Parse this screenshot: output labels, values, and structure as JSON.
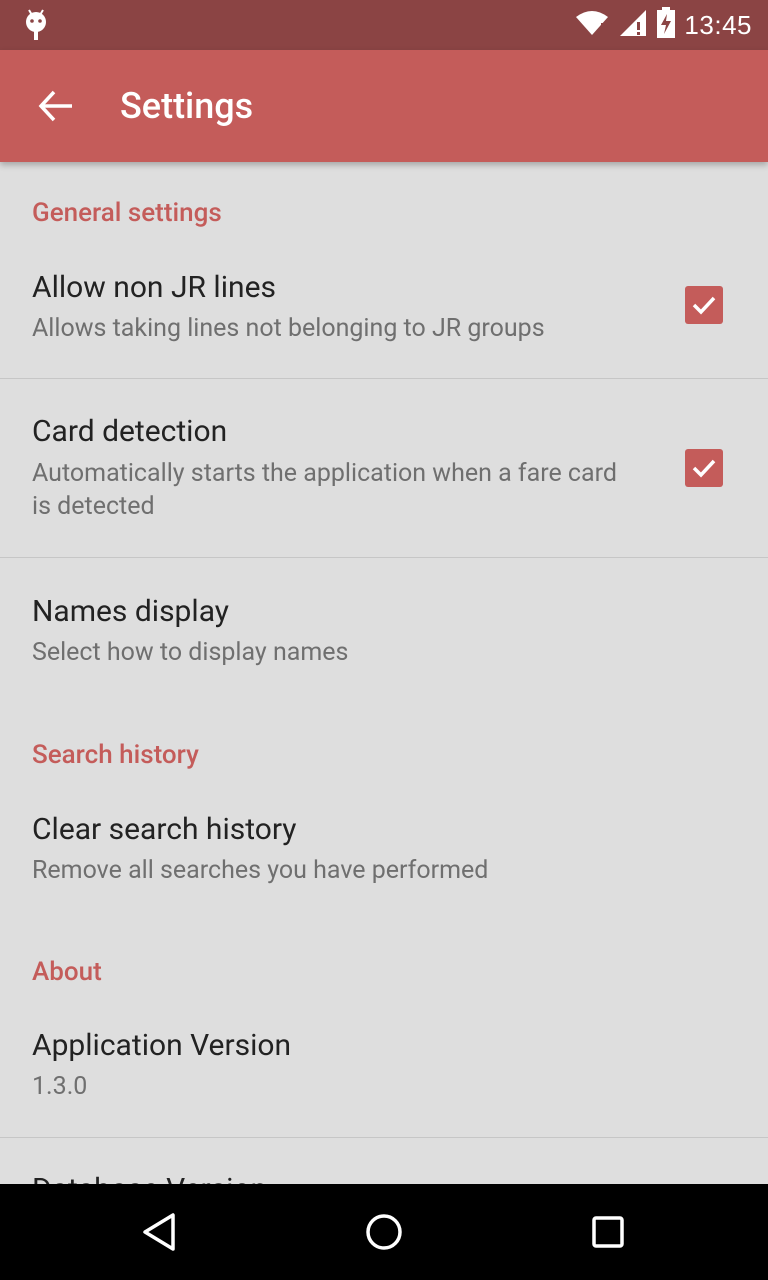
{
  "status_bar": {
    "time": "13:45",
    "icons": [
      "android-icon",
      "wifi-icon",
      "signal-icon",
      "battery-charging-icon"
    ]
  },
  "app_bar": {
    "title": "Settings",
    "back_icon": "arrow-left-icon"
  },
  "sections": {
    "general": {
      "header": "General settings",
      "allow_non_jr": {
        "title": "Allow non JR lines",
        "summary": "Allows taking lines not belonging to JR groups",
        "checked": true
      },
      "card_detection": {
        "title": "Card detection",
        "summary": "Automatically starts the application when a fare card is detected",
        "checked": true
      },
      "names_display": {
        "title": "Names display",
        "summary": "Select how to display names"
      }
    },
    "search_history": {
      "header": "Search history",
      "clear": {
        "title": "Clear search history",
        "summary": "Remove all searches you have performed"
      }
    },
    "about": {
      "header": "About",
      "app_version": {
        "title": "Application Version",
        "summary": "1.3.0"
      },
      "database_version": {
        "title": "Database Version"
      }
    }
  },
  "nav_bar": {
    "icons": [
      "back-triangle-icon",
      "home-circle-icon",
      "recents-square-icon"
    ]
  },
  "colors": {
    "accent": "#c45c5a",
    "status_bar": "#8b4444",
    "background": "#dedede"
  }
}
